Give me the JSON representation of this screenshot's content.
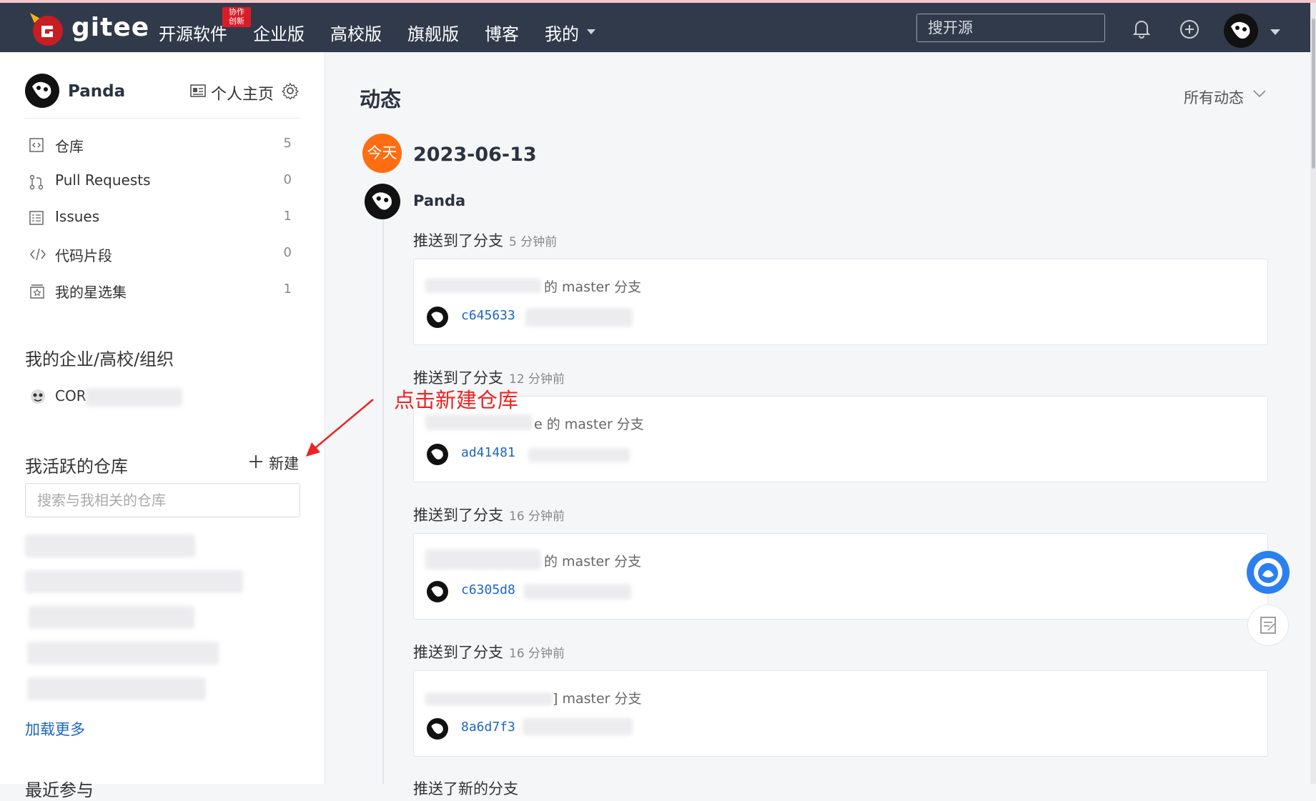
{
  "header": {
    "logo_text": "gitee",
    "nav": [
      {
        "label": "开源软件"
      },
      {
        "label": "企业版"
      },
      {
        "label": "高校版"
      },
      {
        "label": "旗舰版"
      },
      {
        "label": "博客"
      },
      {
        "label": "我的"
      }
    ],
    "badge": "协作\n创新",
    "search_placeholder": "搜开源"
  },
  "sidebar": {
    "user_name": "Panda",
    "home_label": "个人主页",
    "menu": [
      {
        "label": "仓库",
        "count": "5",
        "icon": "code-box-icon"
      },
      {
        "label": "Pull Requests",
        "count": "0",
        "icon": "pull-request-icon"
      },
      {
        "label": "Issues",
        "count": "1",
        "icon": "issues-icon"
      },
      {
        "label": "代码片段",
        "count": "0",
        "icon": "code-snippet-icon"
      },
      {
        "label": "我的星选集",
        "count": "1",
        "icon": "star-collection-icon"
      }
    ],
    "orgs_title": "我的企业/高校/组织",
    "org_label": "COR",
    "active_repos_title": "我活跃的仓库",
    "new_label": "新建",
    "repo_search_placeholder": "搜索与我相关的仓库",
    "load_more": "加载更多",
    "recent_title": "最近参与"
  },
  "feed": {
    "title": "动态",
    "filter": "所有动态",
    "today_label": "今天",
    "date": "2023-06-13",
    "user": "Panda",
    "events": [
      {
        "action": "推送到了分支",
        "time": "5 分钟前",
        "branch_text": "的 master 分支",
        "commit": "c645633"
      },
      {
        "action": "推送到了分支",
        "time": "12 分钟前",
        "branch_text": "e 的 master 分支",
        "commit": "ad41481"
      },
      {
        "action": "推送到了分支",
        "time": "16 分钟前",
        "branch_text": "的 master 分支",
        "commit": "c6305d8"
      },
      {
        "action": "推送到了分支",
        "time": "16 分钟前",
        "branch_text": "] master 分支",
        "commit": "8a6d7f3"
      }
    ],
    "next_event": "推送了新的分支"
  },
  "annotation": {
    "text": "点击新建仓库",
    "color": "#ee2222"
  },
  "colors": {
    "navbar": "#313a4b",
    "accent_orange": "#fe6d12",
    "link_blue": "#1a66c6",
    "brand_red": "#d91d28"
  }
}
